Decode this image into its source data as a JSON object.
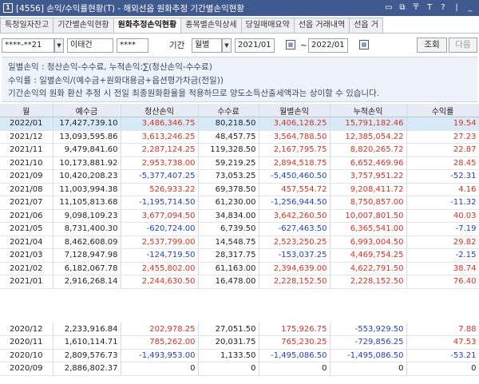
{
  "titlebar": {
    "app_icon": "1",
    "title": "[4556] 손익/수익률현황(T) - 해외선옵 원화추정 기간별손익현황",
    "window_buttons": [
      "▭",
      "⧉",
      "〒",
      "T",
      "?",
      "|",
      "_"
    ]
  },
  "tabs": [
    {
      "label": "특정일자잔고",
      "active": false
    },
    {
      "label": "기간별손익현황",
      "active": false
    },
    {
      "label": "원화추정손익현황",
      "active": true
    },
    {
      "label": "종목별손익상세",
      "active": false
    },
    {
      "label": "당일매매요약",
      "active": false
    },
    {
      "label": "선옵 거래내역",
      "active": false
    },
    {
      "label": "선옵 거",
      "active": false
    }
  ],
  "filter": {
    "account": "****-**21",
    "name": "이태건",
    "password": "****",
    "period_label": "기간",
    "period_unit": "월별",
    "from_date": "2021/01",
    "tilde": "~",
    "to_date": "2022/01",
    "query_button": "조회",
    "next_button": "다음",
    "arrow": "▼",
    "calendar_icon": "▦"
  },
  "info": {
    "line1": "일별손익 : 청산손익-수수료, 누적손익:∑(청산손익-수수료)",
    "line2": "수익률 : 일별손익/(예수금+원화대용금+옵션평가차금(전일))",
    "line3": "기간손익의 원화 환산 추정 시 전일 최종원화환율을 적용하므로 양도소득산출세액과는 상이할 수 있습니다."
  },
  "table": {
    "headers": [
      "월",
      "예수금",
      "청산손익",
      "수수료",
      "월별손익",
      "누적손익",
      "수익률"
    ],
    "rows": [
      [
        "2022/01",
        "17,427,739.10",
        "3,486,346.75",
        "80,218.50",
        "3,406,128.25",
        "15,791,182.46",
        "19.54"
      ],
      [
        "2021/12",
        "13,093,595.86",
        "3,613,246.25",
        "48,457.75",
        "3,564,788.50",
        "12,385,054.22",
        "27.23"
      ],
      [
        "2021/11",
        "9,479,841.60",
        "2,287,124.25",
        "119,328.50",
        "2,167,795.75",
        "8,820,265.72",
        "22.87"
      ],
      [
        "2021/10",
        "10,173,881.92",
        "2,953,738.00",
        "59,219.25",
        "2,894,518.75",
        "6,652,469.96",
        "28.45"
      ],
      [
        "2021/09",
        "10,420,208.23",
        "-5,377,407.25",
        "73,053.25",
        "-5,450,460.50",
        "3,757,951.22",
        "-52.31"
      ],
      [
        "2021/08",
        "11,003,994.38",
        "526,933.22",
        "69,378.50",
        "457,554.72",
        "9,208,411.72",
        "4.16"
      ],
      [
        "2021/07",
        "11,105,813.68",
        "-1,195,714.50",
        "61,230.00",
        "-1,256,944.50",
        "8,750,857.00",
        "-11.32"
      ],
      [
        "2021/06",
        "9,098,109.23",
        "3,677,094.50",
        "34,834.00",
        "3,642,260.50",
        "10,007,801.50",
        "40.03"
      ],
      [
        "2021/05",
        "8,731,400.30",
        "-620,724.00",
        "6,739.50",
        "-627,463.50",
        "6,365,541.00",
        "-7.19"
      ],
      [
        "2021/04",
        "8,462,608.09",
        "2,537,799.00",
        "14,548.75",
        "2,523,250.25",
        "6,993,004.50",
        "29.82"
      ],
      [
        "2021/03",
        "7,128,947.98",
        "-124,719.50",
        "28,317.75",
        "-153,037.25",
        "4,469,754.25",
        "-2.15"
      ],
      [
        "2021/02",
        "6,182,067.78",
        "2,455,802.00",
        "61,163.00",
        "2,394,639.00",
        "4,622,791.50",
        "38.74"
      ],
      [
        "2021/01",
        "2,916,268.14",
        "2,244,630.50",
        "16,478.00",
        "2,228,152.50",
        "2,228,152.50",
        "76.40"
      ]
    ],
    "row_colors": [
      [
        "",
        "",
        "pos",
        "",
        "pos",
        "pos",
        "pos"
      ],
      [
        "",
        "",
        "pos",
        "",
        "pos",
        "pos",
        "pos"
      ],
      [
        "",
        "",
        "pos",
        "",
        "pos",
        "pos",
        "pos"
      ],
      [
        "",
        "",
        "pos",
        "",
        "pos",
        "pos",
        "pos"
      ],
      [
        "",
        "",
        "neg",
        "",
        "neg",
        "pos",
        "neg"
      ],
      [
        "",
        "",
        "pos",
        "",
        "pos",
        "pos",
        "pos"
      ],
      [
        "",
        "",
        "neg",
        "",
        "neg",
        "pos",
        "neg"
      ],
      [
        "",
        "",
        "pos",
        "",
        "pos",
        "pos",
        "pos"
      ],
      [
        "",
        "",
        "neg",
        "",
        "neg",
        "pos",
        "neg"
      ],
      [
        "",
        "",
        "pos",
        "",
        "pos",
        "pos",
        "pos"
      ],
      [
        "",
        "",
        "neg",
        "",
        "neg",
        "pos",
        "neg"
      ],
      [
        "",
        "",
        "pos",
        "",
        "pos",
        "pos",
        "pos"
      ],
      [
        "",
        "",
        "pos",
        "",
        "pos",
        "pos",
        "pos"
      ]
    ]
  },
  "table2": {
    "rows": [
      [
        "2020/12",
        "2,233,916.84",
        "202,978.25",
        "27,051.50",
        "175,926.75",
        "-553,929.50",
        "7.88"
      ],
      [
        "2020/11",
        "1,610,114.71",
        "785,262.00",
        "20,031.75",
        "765,230.25",
        "-729,856.25",
        "47.53"
      ],
      [
        "2020/10",
        "2,809,576.73",
        "-1,493,953.00",
        "1,133.50",
        "-1,495,086.50",
        "-1,495,086.50",
        "-53.21"
      ],
      [
        "2020/09",
        "2,886,802.37",
        "0",
        "0",
        "0",
        "0",
        "0"
      ]
    ],
    "row_colors": [
      [
        "",
        "",
        "pos",
        "",
        "pos",
        "neg",
        "pos"
      ],
      [
        "",
        "",
        "pos",
        "",
        "pos",
        "neg",
        "pos"
      ],
      [
        "",
        "",
        "neg",
        "",
        "neg",
        "neg",
        "neg"
      ],
      [
        "",
        "",
        "",
        "",
        "",
        "",
        ""
      ]
    ]
  }
}
